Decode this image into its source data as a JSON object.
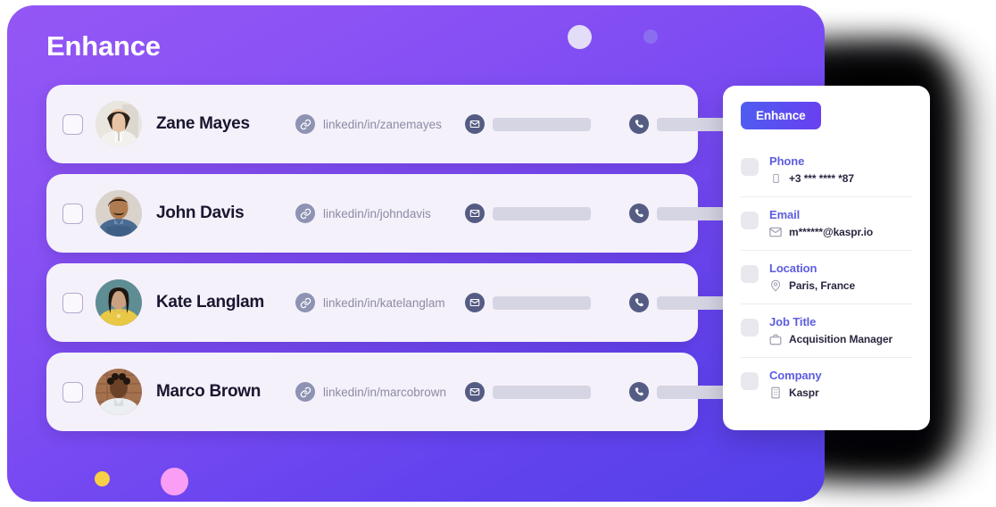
{
  "page": {
    "title": "Enhance"
  },
  "colors": {
    "card_gradient_start": "#9457f5",
    "card_gradient_end": "#5340e8",
    "row_background": "#f4f1fa",
    "accent_blue": "#5c5ce0",
    "enhance_button_start": "#4f5df0",
    "enhance_button_end": "#6a3ff0",
    "dot_white": "#e4ddf7",
    "dot_purple": "#8a6ef0",
    "dot_yellow": "#f7d046",
    "dot_pink": "#fa9ef5",
    "icon_link": "#8e93b3",
    "icon_mail": "#555c84",
    "icon_phone": "#555c84",
    "placeholder_bar": "#d6d5e3"
  },
  "decorations": [
    {
      "name": "dot-large-white",
      "color": "#e4ddf7"
    },
    {
      "name": "dot-small-purple",
      "color": "#8a6ef0"
    },
    {
      "name": "dot-small-yellow",
      "color": "#f7d046"
    },
    {
      "name": "dot-medium-pink",
      "color": "#fa9ef5"
    }
  ],
  "contacts": [
    {
      "name": "Zane Mayes",
      "linkedin": "linkedin/in/zanemayes",
      "email_hidden": true,
      "phone_hidden": true,
      "avatar": "woman-dark-hair",
      "checked": false
    },
    {
      "name": "John Davis",
      "linkedin": "linkedin/in/johndavis",
      "email_hidden": true,
      "phone_hidden": true,
      "avatar": "man-beard-blue-shirt",
      "checked": false
    },
    {
      "name": "Kate Langlam",
      "linkedin": "linkedin/in/katelanglam",
      "email_hidden": true,
      "phone_hidden": true,
      "avatar": "woman-yellow-top",
      "checked": false
    },
    {
      "name": "Marco Brown",
      "linkedin": "linkedin/in/marcobrown",
      "email_hidden": true,
      "phone_hidden": true,
      "avatar": "man-curly-hair",
      "checked": false
    }
  ],
  "icons": {
    "link": "link-icon",
    "mail": "mail-icon",
    "phone": "phone-icon"
  },
  "detail_panel": {
    "enhance_label": "Enhance",
    "items": [
      {
        "label": "Phone",
        "value": "+3 *** **** *87",
        "icon": "mobile-icon",
        "checked": false
      },
      {
        "label": "Email",
        "value": "m******@kaspr.io",
        "icon": "envelope-icon",
        "checked": false
      },
      {
        "label": "Location",
        "value": "Paris, France",
        "icon": "pin-icon",
        "checked": false
      },
      {
        "label": "Job Title",
        "value": "Acquisition Manager",
        "icon": "briefcase-icon",
        "checked": false
      },
      {
        "label": "Company",
        "value": "Kaspr",
        "icon": "building-icon",
        "checked": false
      }
    ]
  }
}
